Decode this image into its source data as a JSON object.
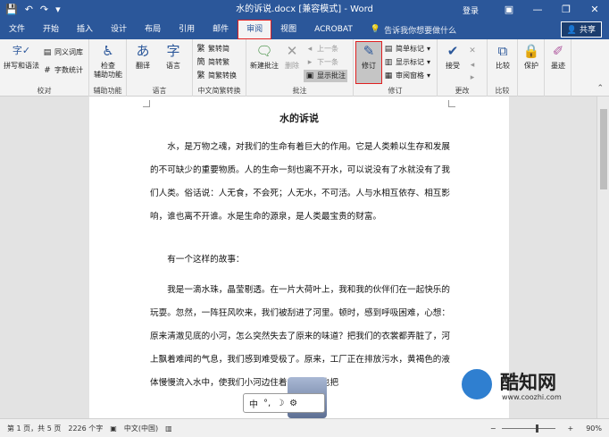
{
  "titlebar": {
    "title": "水的诉说.docx [兼容模式] - Word",
    "login": "登录",
    "qat": {
      "save": "💾",
      "undo": "↶",
      "redo": "↷",
      "more": "▾"
    },
    "controls": {
      "ribbon_opts": "▣",
      "minimize": "—",
      "restore": "❐",
      "close": "✕"
    }
  },
  "tabs": [
    "文件",
    "开始",
    "插入",
    "设计",
    "布局",
    "引用",
    "邮件",
    "审阅",
    "视图",
    "ACROBAT"
  ],
  "active_tab": "审阅",
  "tellme": "告诉我你想要做什么",
  "share": "共享",
  "ribbon": {
    "proofing": {
      "label": "校对",
      "spell": "拼写和语法",
      "thesaurus": "同义词库",
      "wordcount": "字数统计"
    },
    "accessibility": {
      "label": "辅助功能",
      "check": "检查\n辅助功能"
    },
    "language": {
      "label": "语言",
      "translate": "翻译",
      "language": "语言"
    },
    "chinese": {
      "label": "中文简繁转换",
      "to_trad": "繁转简",
      "to_simp": "简转繁",
      "convert": "简繁转换"
    },
    "comments": {
      "label": "批注",
      "new": "新建批注",
      "delete": "删除",
      "prev": "上一条",
      "next": "下一条",
      "show": "显示批注"
    },
    "tracking": {
      "label": "修订",
      "track": "修订",
      "markup": "简单标记",
      "show_markup": "显示标记",
      "pane": "审阅窗格"
    },
    "changes": {
      "label": "更改",
      "accept": "接受"
    },
    "compare": {
      "label": "比较",
      "compare": "比较"
    },
    "protect": {
      "protect": "保护",
      "ink": "墨迹"
    }
  },
  "document": {
    "title": "水的诉说",
    "paragraphs": [
      "水，是万物之魂，对我们的生命有着巨大的作用。它是人类赖以生存和发展的不可缺少的重要物质。人的生命一刻也离不开水，可以说没有了水就没有了我们人类。俗话说：人无食，不会死；人无水，不可活。人与水相互依存、相互影响，谁也离不开谁。水是生命的源泉，是人类最宝贵的财富。",
      "有一个这样的故事：",
      "我是一滴水珠，晶莹剔透。在一片大荷叶上，我和我的伙伴们在一起快乐的玩耍。忽然，一阵狂风吹来，我们被刮进了河里。顿时，感到呼吸困难，心想：原来清澈见底的小河，怎么突然失去了原来的味道？把我们的衣裳都弄脏了，河上飘着难闻的气息，我们感到难受极了。原来，工厂正在排放污水，黄褐色的液体慢慢流入水中，使我们小河边住着的居民们也把"
    ]
  },
  "ime": {
    "mode": "中",
    "punct": "°,",
    "moon": "☽",
    "gear": "⚙"
  },
  "watermark": {
    "brand": "酷知网",
    "url": "www.coozhi.com"
  },
  "status": {
    "page": "第 1 页，共 5 页",
    "words": "2226 个字",
    "lang": "中文(中国)",
    "zoom": "90%"
  }
}
